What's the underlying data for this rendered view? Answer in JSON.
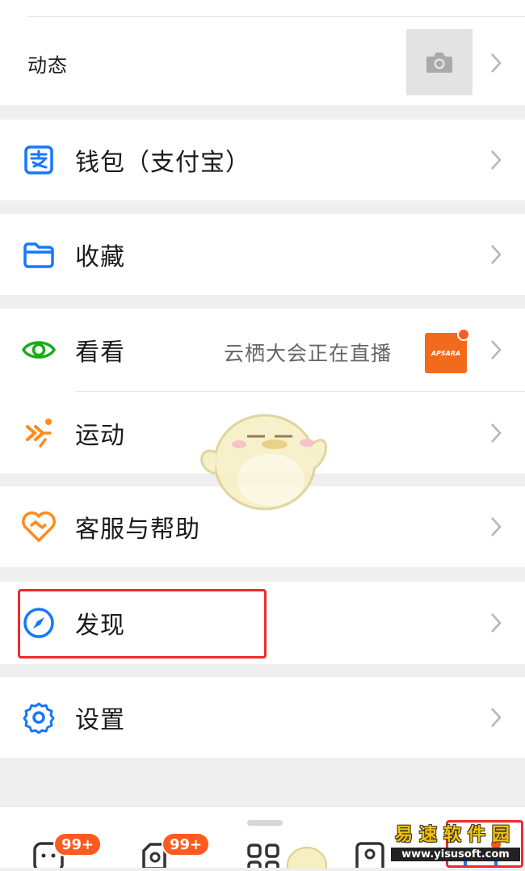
{
  "moments": {
    "label": "动态"
  },
  "menu": {
    "wallet": {
      "label": "钱包（支付宝）"
    },
    "favorites": {
      "label": "收藏"
    },
    "watch": {
      "label": "看看",
      "subtitle": "云栖大会正在直播",
      "thumb_text": "APSARA"
    },
    "sports": {
      "label": "运动"
    },
    "help": {
      "label": "客服与帮助"
    },
    "discover": {
      "label": "发现"
    },
    "settings": {
      "label": "设置"
    }
  },
  "tabbar": {
    "messages_badge": "99+",
    "contacts_badge": "99+"
  },
  "watermark": {
    "brand": "易速软件园",
    "url": "www.yisusoft.com"
  },
  "colors": {
    "accent_blue": "#1677ff",
    "green": "#1aad19",
    "orange": "#ff8c1a",
    "badge": "#ff5a1f",
    "highlight": "#ee2b2b"
  },
  "icons": [
    "camera-icon",
    "alipay-icon",
    "folder-icon",
    "eye-icon",
    "running-icon",
    "heart-service-icon",
    "compass-icon",
    "gear-icon"
  ]
}
